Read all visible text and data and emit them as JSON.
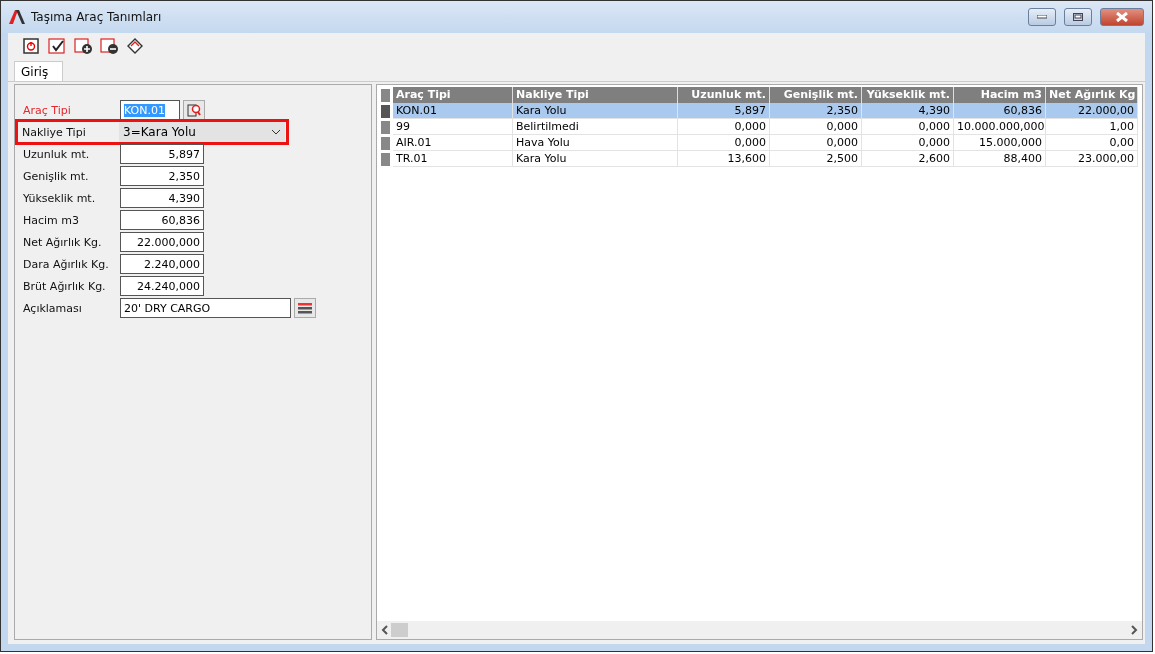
{
  "window": {
    "title": "Taşıma Araç Tanımları"
  },
  "tabs": [
    {
      "label": "Giriş",
      "selected": true
    }
  ],
  "form": {
    "fields": [
      {
        "kind": "lookup",
        "label": "Araç Tipi",
        "value": "KON.01",
        "required": true,
        "highlighted": false
      },
      {
        "kind": "select",
        "label": "Nakliye Tipi",
        "value": "3=Kara Yolu",
        "required": false,
        "highlighted": true
      },
      {
        "kind": "number",
        "label": "Uzunluk mt.",
        "value": "5,897",
        "required": false,
        "highlighted": false
      },
      {
        "kind": "number",
        "label": "Genişlik mt.",
        "value": "2,350",
        "required": false,
        "highlighted": false
      },
      {
        "kind": "number",
        "label": "Yükseklik mt.",
        "value": "4,390",
        "required": false,
        "highlighted": false
      },
      {
        "kind": "number",
        "label": "Hacim m3",
        "value": "60,836",
        "required": false,
        "highlighted": false
      },
      {
        "kind": "number",
        "label": "Net Ağırlık Kg.",
        "value": "22.000,000",
        "required": false,
        "highlighted": false
      },
      {
        "kind": "number",
        "label": "Dara Ağırlık Kg.",
        "value": "2.240,000",
        "required": false,
        "highlighted": false
      },
      {
        "kind": "number",
        "label": "Brüt Ağırlık Kg.",
        "value": "24.240,000",
        "required": false,
        "highlighted": false
      },
      {
        "kind": "memo",
        "label": "Açıklaması",
        "value": "20' DRY CARGO",
        "required": false,
        "highlighted": false
      }
    ]
  },
  "table": {
    "columns": [
      "Araç Tipi",
      "Nakliye Tipi",
      "Uzunluk mt.",
      "Genişlik mt.",
      "Yükseklik mt.",
      "Hacim m3",
      "Net Ağırlık Kg"
    ],
    "rows": [
      {
        "selected": true,
        "cells": [
          "KON.01",
          "Kara Yolu",
          "5,897",
          "2,350",
          "4,390",
          "60,836",
          "22.000,00"
        ]
      },
      {
        "selected": false,
        "cells": [
          "99",
          "Belirtilmedi",
          "0,000",
          "0,000",
          "0,000",
          "10.000.000,000",
          "1,00"
        ]
      },
      {
        "selected": false,
        "cells": [
          "AIR.01",
          "Hava Yolu",
          "0,000",
          "0,000",
          "0,000",
          "15.000,000",
          "0,00"
        ]
      },
      {
        "selected": false,
        "cells": [
          "TR.01",
          "Kara Yolu",
          "13,600",
          "2,500",
          "2,600",
          "88,400",
          "23.000,00"
        ]
      }
    ]
  }
}
